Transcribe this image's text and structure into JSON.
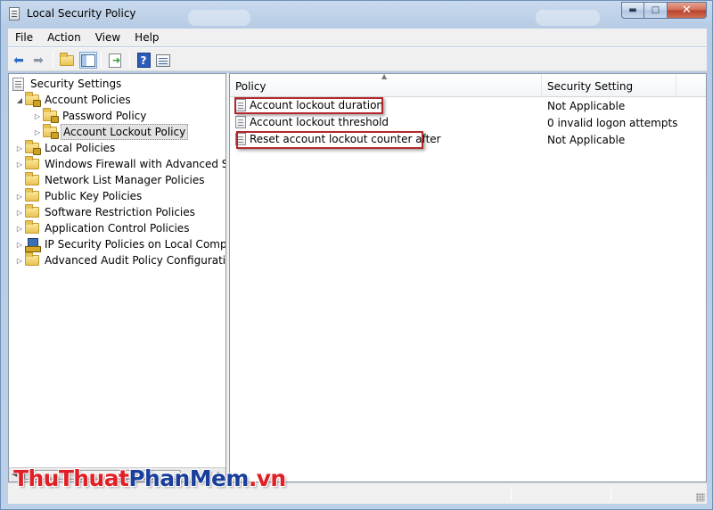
{
  "window": {
    "title": "Local Security Policy",
    "controls": {
      "minimize": "▬",
      "maximize": "□",
      "close": "✕"
    }
  },
  "menu": [
    "File",
    "Action",
    "View",
    "Help"
  ],
  "toolbar": {
    "icons": [
      "back-arrow-icon",
      "forward-arrow-icon",
      "up-folder-icon",
      "show-hide-tree-icon",
      "export-list-icon",
      "help-icon",
      "view-icon"
    ]
  },
  "tree": {
    "root": "Security Settings",
    "account_policies": "Account Policies",
    "password_policy": "Password Policy",
    "account_lockout_policy": "Account Lockout Policy",
    "local_policies": "Local Policies",
    "windows_firewall": "Windows Firewall with Advanced Secu",
    "network_list": "Network List Manager Policies",
    "public_key": "Public Key Policies",
    "software_restriction": "Software Restriction Policies",
    "application_control": "Application Control Policies",
    "ip_security": "IP Security Policies on Local Compute",
    "advanced_audit": "Advanced Audit Policy Configuration"
  },
  "list": {
    "columns": [
      "Policy",
      "Security Setting"
    ],
    "rows": [
      {
        "policy": "Account lockout duration",
        "setting": "Not Applicable"
      },
      {
        "policy": "Account lockout threshold",
        "setting": "0 invalid logon attempts"
      },
      {
        "policy": "Reset account lockout counter after",
        "setting": "Not Applicable"
      }
    ]
  },
  "watermark": {
    "part1": "ThuThuat",
    "part2": "PhanMem",
    "part3": ".vn"
  },
  "colors": {
    "highlight_border": "#b3282d",
    "watermark_red": "#e11f26",
    "watermark_blue": "#1a3f9a"
  }
}
